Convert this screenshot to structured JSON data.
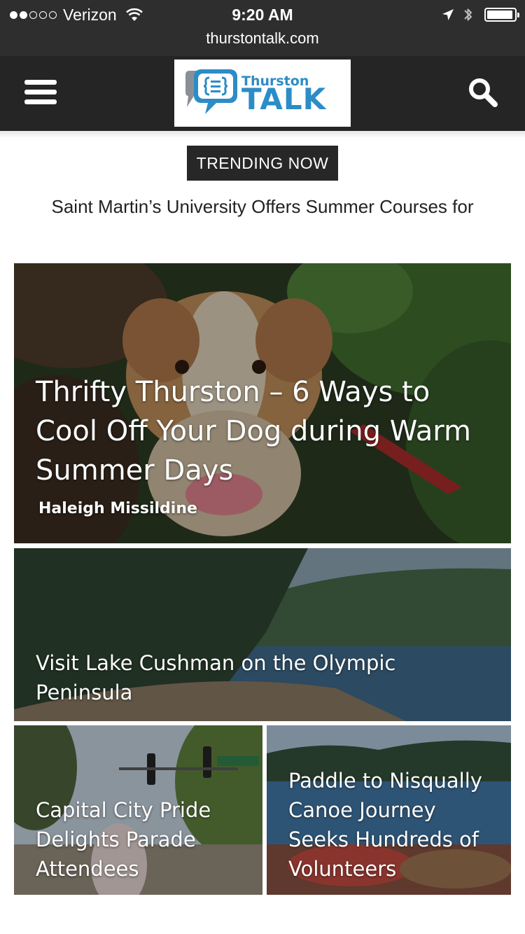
{
  "status_bar": {
    "carrier": "Verizon",
    "signal_bars_filled": 2,
    "signal_bars_total": 5,
    "time": "9:20 AM",
    "icons": [
      "wifi-icon",
      "location-arrow-icon",
      "bluetooth-icon",
      "battery-icon"
    ],
    "battery_level": 0.95
  },
  "browser": {
    "url": "thurstontalk.com"
  },
  "header": {
    "menu_icon": "hamburger-menu-icon",
    "search_icon": "search-icon",
    "logo": {
      "line1": "Thurston",
      "line2": "TALK"
    }
  },
  "trending": {
    "badge": "TRENDING NOW",
    "headline": "Saint Martin’s University Offers Summer Courses for"
  },
  "articles": [
    {
      "title": "Thrifty Thurston – 6 Ways to Cool Off Your Dog during Warm Summer Days",
      "author": "Haleigh Missildine"
    },
    {
      "title": "Visit Lake Cushman on the Olympic Peninsula"
    },
    {
      "title": "Capital City Pride Delights Parade Attendees"
    },
    {
      "title": "Paddle to Nisqually Canoe Journey Seeks Hundreds of Volunteers"
    }
  ],
  "colors": {
    "status_bar_bg": "#2e2e2e",
    "header_bg": "#252525",
    "logo_blue": "#2c8cc7",
    "badge_bg": "#272727"
  }
}
